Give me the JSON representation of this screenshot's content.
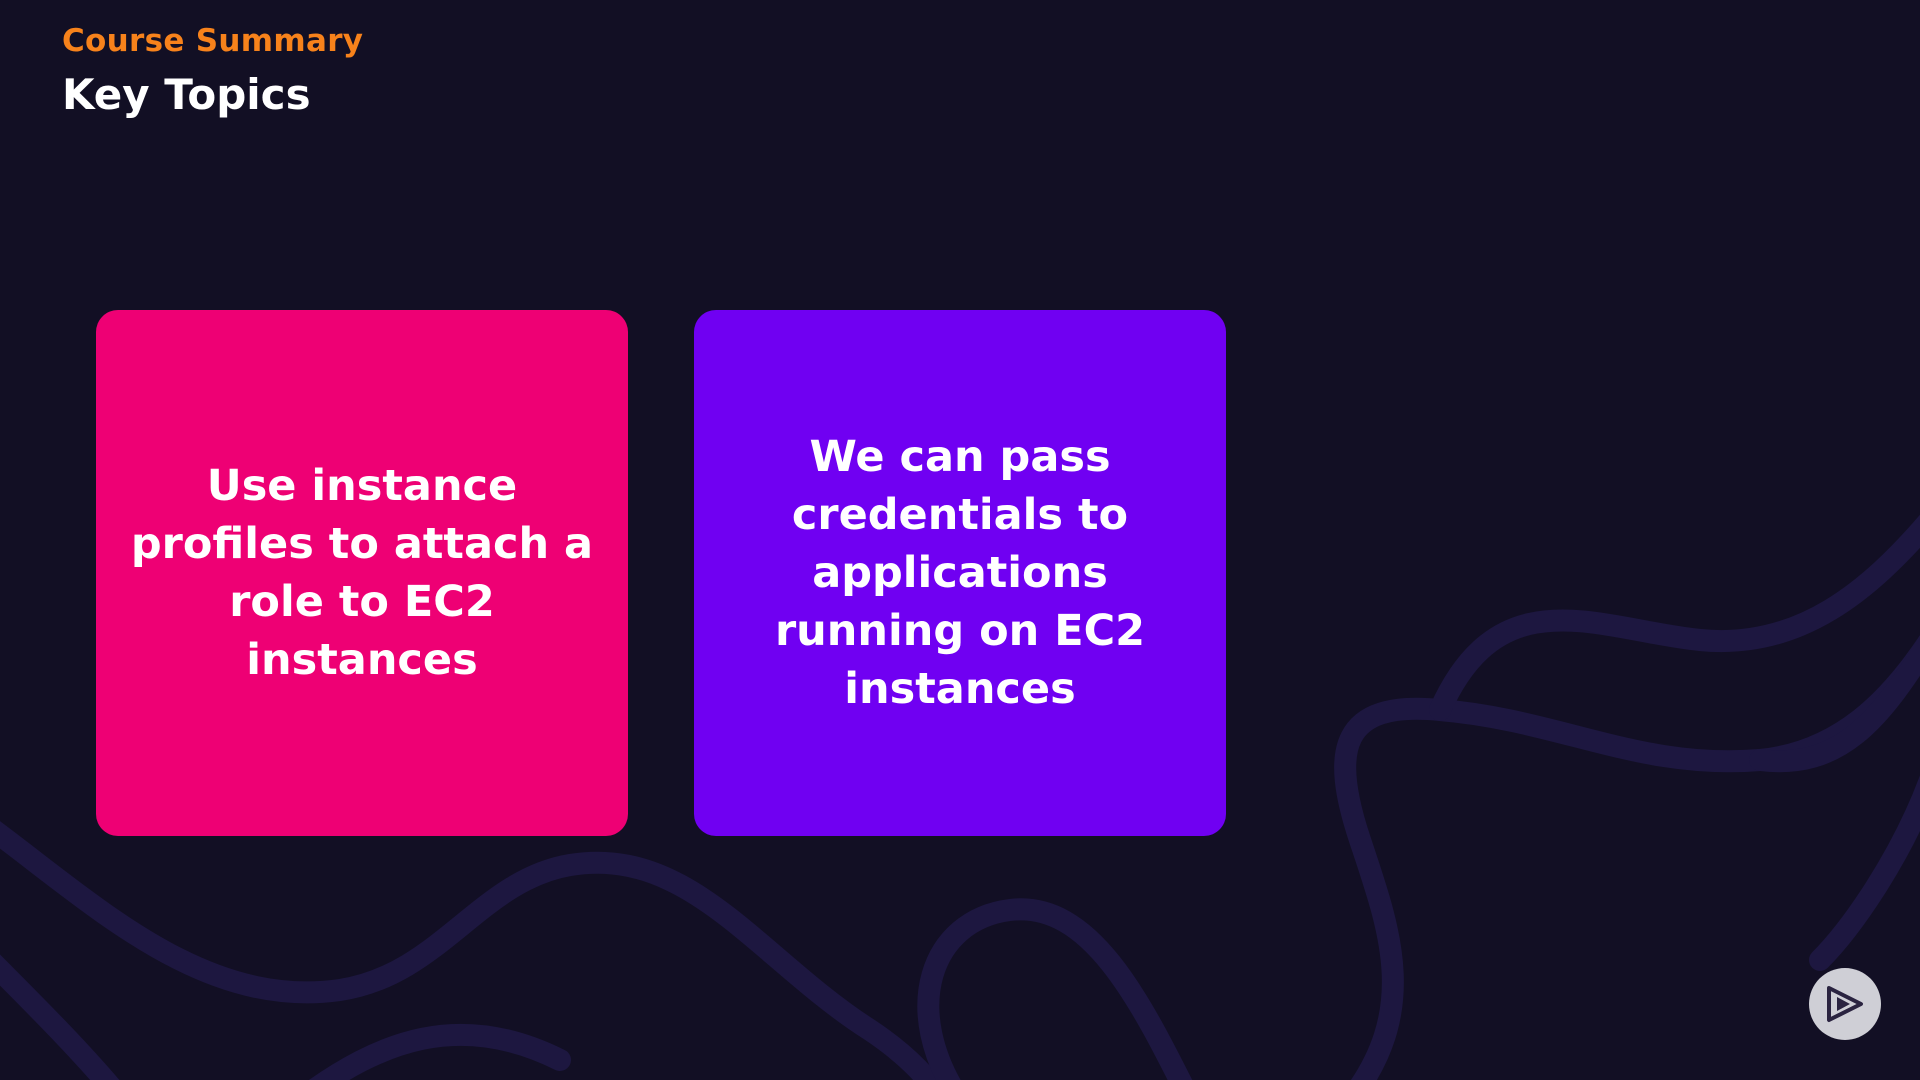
{
  "header": {
    "eyebrow": "Course Summary",
    "title": "Key Topics"
  },
  "cards": [
    {
      "text": "Use instance profiles to attach a role to EC2 instances",
      "color": "#ee0074"
    },
    {
      "text": "We can pass credentials to applications running on EC2 instances",
      "color": "#7000f2"
    }
  ],
  "colors": {
    "background": "#120f24",
    "eyebrow": "#f7821b",
    "swirl": "#1d1740"
  },
  "badge": {
    "icon": "play-icon"
  }
}
